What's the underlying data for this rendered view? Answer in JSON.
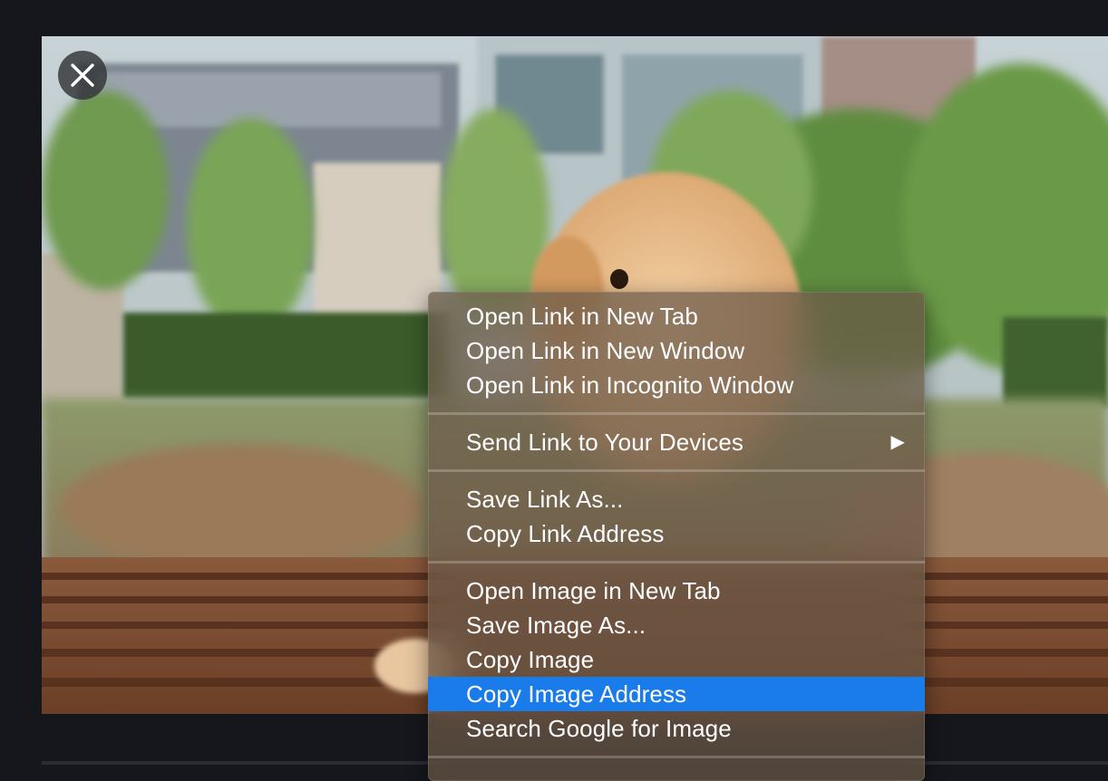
{
  "viewer": {
    "close_icon": "close-icon"
  },
  "context_menu": {
    "groups": [
      {
        "items": [
          {
            "label": "Open Link in New Tab"
          },
          {
            "label": "Open Link in New Window"
          },
          {
            "label": "Open Link in Incognito Window"
          }
        ]
      },
      {
        "items": [
          {
            "label": "Send Link to Your Devices",
            "submenu_icon": "submenu-arrow-icon",
            "submenu_glyph": "▶"
          }
        ]
      },
      {
        "items": [
          {
            "label": "Save Link As..."
          },
          {
            "label": "Copy Link Address"
          }
        ]
      },
      {
        "items": [
          {
            "label": "Open Image in New Tab"
          },
          {
            "label": "Save Image As..."
          },
          {
            "label": "Copy Image"
          },
          {
            "label": "Copy Image Address",
            "highlighted": true
          },
          {
            "label": "Search Google for Image"
          }
        ]
      }
    ],
    "highlight_color": "#1a7cea"
  }
}
